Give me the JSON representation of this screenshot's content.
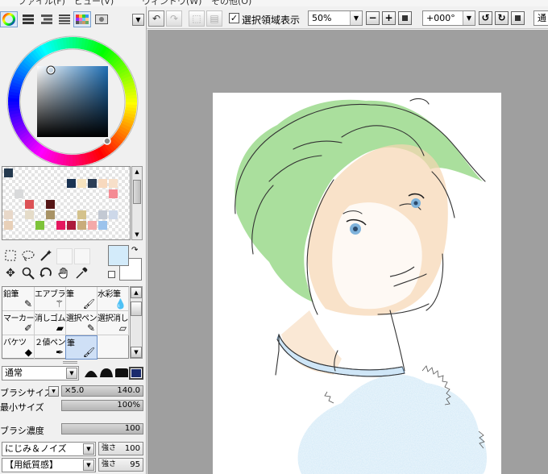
{
  "menu": {
    "items": [
      "ファイル(F)",
      "ビュー(V)",
      "ウィンドウ(W)",
      "その他(O)"
    ]
  },
  "toolbar": {
    "selection_label": "選択領域表示",
    "selection_checked": "✓",
    "zoom_value": "50%",
    "rotation_value": "+000°",
    "blend_partial": "通"
  },
  "color_tabs": [
    "color-wheel",
    "rgb-sliders",
    "hsv-sliders",
    "color-history",
    "swatches",
    "scratchpad"
  ],
  "colors": {
    "foreground": "#d3ebfa",
    "background": "#ffffff",
    "hue_square": "#1e6fb5"
  },
  "swatches": [
    "#253a4f",
    "#1a3353",
    "#f7e4c0",
    "#2b3d55",
    "#f8d9be",
    "#f7dfc9",
    "#f48b94",
    "#d9dadb",
    "#dc5256",
    "#551515",
    "#e8d8c9",
    "#a89366",
    "#c3c9d3",
    "#e5dcc9",
    "#e8d0b8",
    "#d4c28c",
    "#9cc3ec",
    "#7dc33a",
    "#e5175f",
    "#ac1a3b",
    "#c9ac7b",
    "#f4a9a9",
    "#cdd8e9"
  ],
  "brush_tools": [
    {
      "label": "鉛筆",
      "icon": "pencil-icon"
    },
    {
      "label": "エアブラシ",
      "icon": "airbrush-icon"
    },
    {
      "label": "筆",
      "icon": "brush-icon"
    },
    {
      "label": "水彩筆",
      "icon": "watercolor-icon"
    },
    {
      "label": "マーカー",
      "icon": "marker-icon"
    },
    {
      "label": "消しゴム",
      "icon": "eraser-icon"
    },
    {
      "label": "選択ペン",
      "icon": "select-pen-icon"
    },
    {
      "label": "選択消し",
      "icon": "select-erase-icon"
    },
    {
      "label": "バケツ",
      "icon": "bucket-icon"
    },
    {
      "label": "２値ペン",
      "icon": "binary-pen-icon"
    },
    {
      "label": "筆",
      "icon": "brush-icon"
    }
  ],
  "brush_settings": {
    "blend_mode": "通常",
    "size_label": "ブラシサイズ",
    "size_multiplier": "×5.0",
    "size_value": "140.0",
    "min_size_label": "最小サイズ",
    "min_size_value": "100%",
    "density_label": "ブラシ濃度",
    "density_value": "100",
    "texture1": "にじみ＆ノイズ",
    "texture1_strength_label": "強さ",
    "texture1_strength": "100",
    "texture2": "【用紙質感】",
    "texture2_strength_label": "強さ",
    "texture2_strength": "95"
  },
  "art": {
    "hair_color": "#9bd98c",
    "skin_color": "#f6d5b2",
    "collar_color": "#cfe6f7",
    "eye_color": "#7fb3db",
    "fluff_color": "#d6ebf8"
  }
}
